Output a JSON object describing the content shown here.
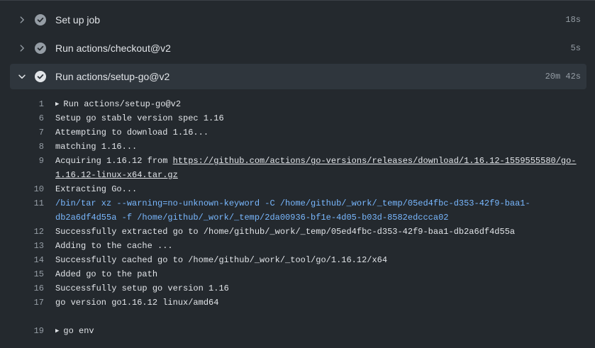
{
  "steps": [
    {
      "title": "Set up job",
      "duration": "18s"
    },
    {
      "title": "Run actions/checkout@v2",
      "duration": "5s"
    },
    {
      "title": "Run actions/setup-go@v2",
      "duration": "20m 42s"
    }
  ],
  "log": {
    "l1": {
      "num": "1",
      "text": "Run actions/setup-go@v2"
    },
    "l6": {
      "num": "6",
      "text": "Setup go stable version spec 1.16"
    },
    "l7": {
      "num": "7",
      "text": "Attempting to download 1.16..."
    },
    "l8": {
      "num": "8",
      "text": "matching 1.16..."
    },
    "l9": {
      "num": "9",
      "text_prefix": "Acquiring 1.16.12 from ",
      "url_line1": "https://github.com/actions/go-versions/releases/download/1.16.12-1559555580/go-",
      "url_line2": "1.16.12-linux-x64.tar.gz"
    },
    "l10": {
      "num": "10",
      "text": "Extracting Go..."
    },
    "l11": {
      "num": "11",
      "text_line1": "/bin/tar xz --warning=no-unknown-keyword -C /home/github/_work/_temp/05ed4fbc-d353-42f9-baa1-",
      "text_line2": "db2a6df4d55a -f /home/github/_work/_temp/2da00936-bf1e-4d05-b03d-8582edccca02"
    },
    "l12": {
      "num": "12",
      "text": "Successfully extracted go to /home/github/_work/_temp/05ed4fbc-d353-42f9-baa1-db2a6df4d55a"
    },
    "l13": {
      "num": "13",
      "text": "Adding to the cache ..."
    },
    "l14": {
      "num": "14",
      "text": "Successfully cached go to /home/github/_work/_tool/go/1.16.12/x64"
    },
    "l15": {
      "num": "15",
      "text": "Added go to the path"
    },
    "l16": {
      "num": "16",
      "text": "Successfully setup go version 1.16"
    },
    "l17": {
      "num": "17",
      "text": "go version go1.16.12 linux/amd64"
    },
    "l19": {
      "num": "19",
      "text": "go env"
    }
  }
}
